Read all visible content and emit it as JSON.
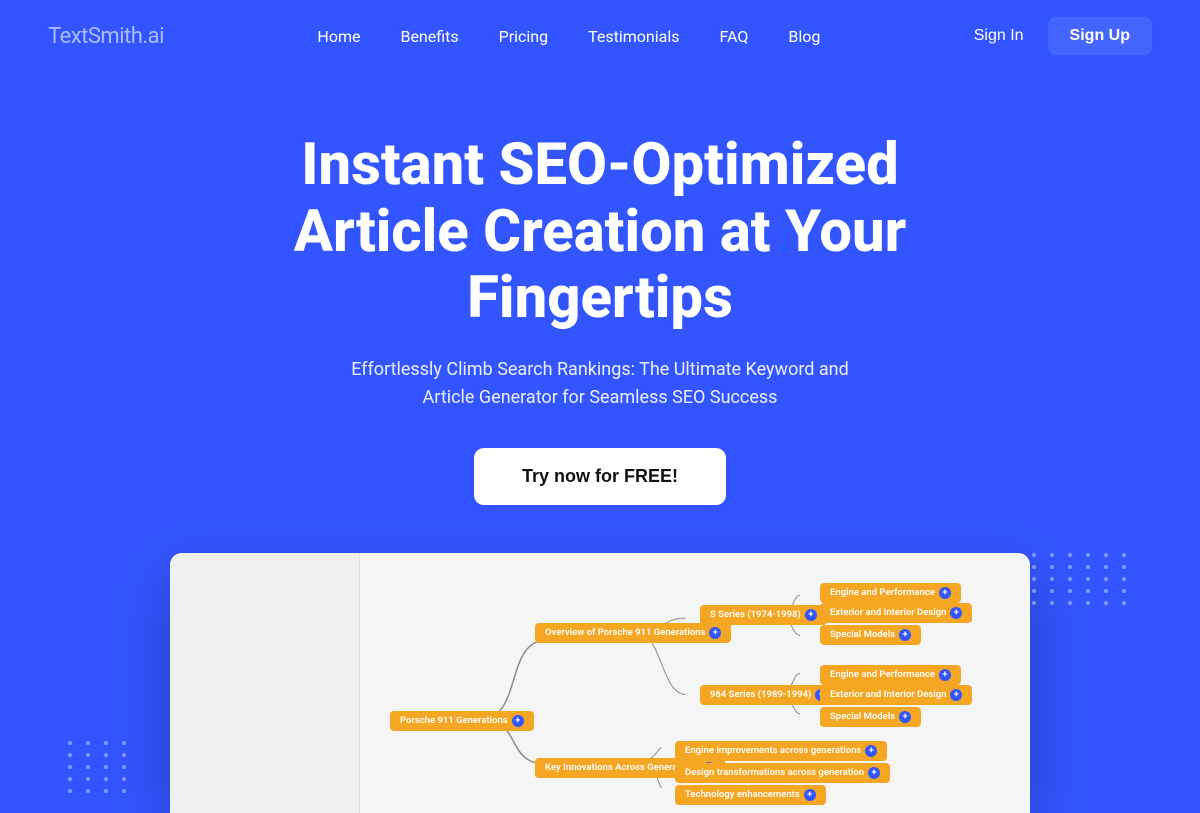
{
  "brand": {
    "name": "TextSmith",
    "suffix": ".ai"
  },
  "nav": {
    "links": [
      {
        "label": "Home",
        "id": "home"
      },
      {
        "label": "Benefits",
        "id": "benefits"
      },
      {
        "label": "Pricing",
        "id": "pricing"
      },
      {
        "label": "Testimonials",
        "id": "testimonials"
      },
      {
        "label": "FAQ",
        "id": "faq"
      },
      {
        "label": "Blog",
        "id": "blog"
      }
    ],
    "sign_in": "Sign In",
    "sign_up": "Sign Up"
  },
  "hero": {
    "title": "Instant SEO-Optimized Article Creation at Your Fingertips",
    "subtitle": "Effortlessly Climb Search Rankings: The Ultimate Keyword and Article Generator for Seamless SEO Success",
    "cta": "Try now for FREE!"
  },
  "mindmap": {
    "root": "Porsche 911 Generations",
    "overview_node": "Overview of Porsche 911 Generations",
    "key_node": "Key Innovations Across Generations",
    "s_series": "S Series (1974-1998)",
    "n964": "964 Series (1989-1994)",
    "engine_imp": "Engine improvements across generations",
    "design_trans": "Design transformations across generation",
    "tech_enh": "Technology enhancements",
    "ep1": "Engine and Performance",
    "ext1": "Exterior and Interior Design",
    "spec1": "Special Models",
    "ep2": "Engine and Performance",
    "ext2": "Exterior and Interior Design",
    "spec2": "Special Models"
  },
  "colors": {
    "bg": "#3355ff",
    "node_bg": "#f5a623",
    "node_dot": "#3355ff",
    "cta_bg": "#ffffff",
    "signup_bg": "#4466ff"
  }
}
